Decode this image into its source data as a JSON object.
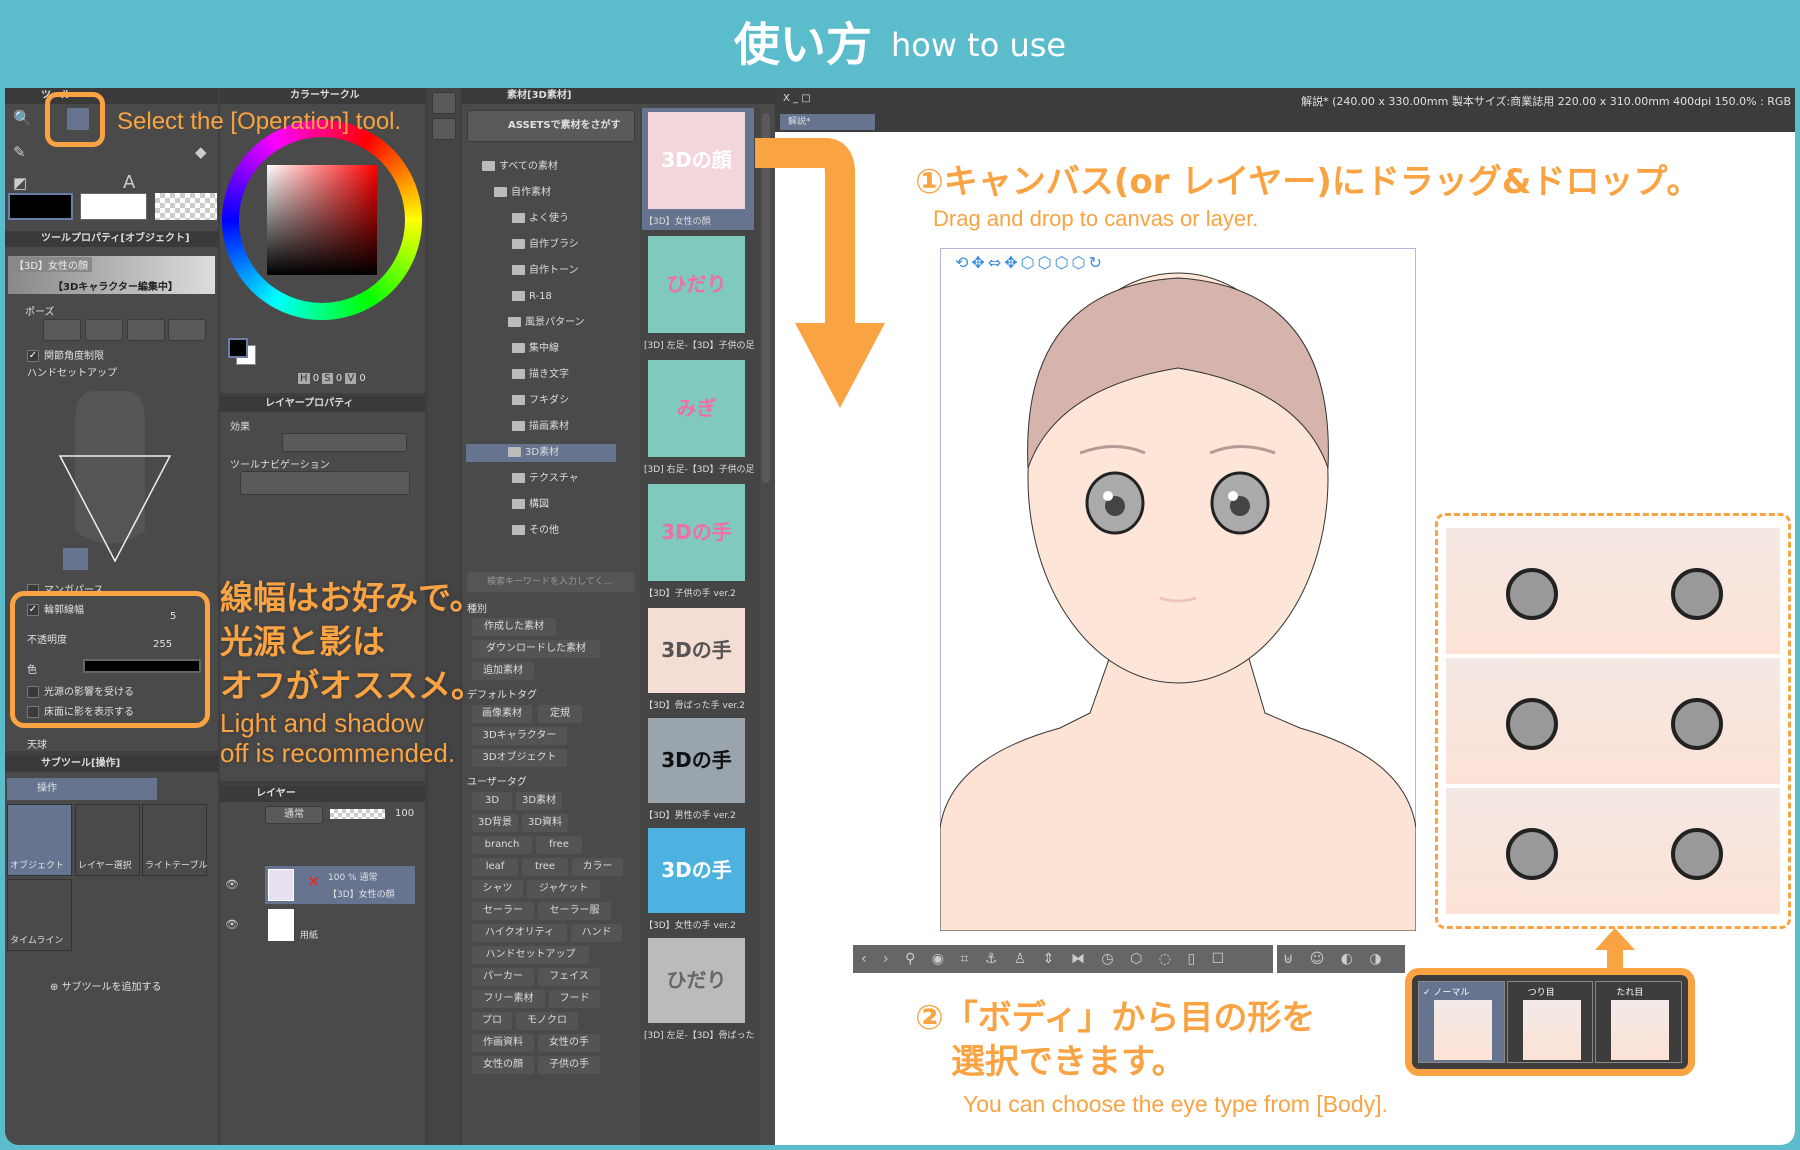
{
  "header": {
    "title_ja": "使い方",
    "title_en": "how to use"
  },
  "colors": {
    "teal": "#5bbdcc",
    "orange": "#f9a342",
    "panel": "#4a4a4a",
    "selected": "#66748f"
  },
  "annotations": {
    "select_tool": "Select the [Operation] tool.",
    "line_ja_1": "線幅はお好みで。",
    "line_ja_2": "光源と影は",
    "line_ja_3": "オフがオススメ。",
    "line_en_1": "Light and shadow",
    "line_en_2": "off is recommended.",
    "step1_ja": "①キャンバス(or レイヤー)にドラッグ&ドロップ。",
    "step1_en": "Drag and drop to canvas or layer.",
    "step2_ja_1": "②「ボディ」から目の形を",
    "step2_ja_2": "選択できます。",
    "step2_en": "You can choose the eye type from [Body]."
  },
  "tool_panel": {
    "tab": "ツール",
    "property_title": "ツールプロパティ[オブジェクト]",
    "material_name": "【3D】女性の顔",
    "editing": "【3Dキャラクター編集中】",
    "pose": "ポーズ",
    "joint_limit": "関節角度制限",
    "hand_setup": "ハンドセットアップ",
    "manga_perspective": "マンガパース",
    "outline_width": {
      "label": "輪郭線幅",
      "value": "5",
      "checked": true
    },
    "opacity": {
      "label": "不透明度",
      "value": "255"
    },
    "color_label": "色",
    "light_effect": {
      "label": "光源の影響を受ける",
      "checked": false
    },
    "floor_shadow": {
      "label": "床面に影を表示する",
      "checked": false
    },
    "sky": "天球"
  },
  "subtool": {
    "title": "サブツール[操作]",
    "group": "操作",
    "items": [
      {
        "label": "オブジェクト"
      },
      {
        "label": "レイヤー選択"
      },
      {
        "label": "ライトテーブル"
      },
      {
        "label": "タイムライン"
      }
    ],
    "add": "サブツールを追加する"
  },
  "color_panel": {
    "title": "カラーサークル",
    "h": "0",
    "s": "0",
    "v": "0",
    "h_label": "H",
    "s_label": "S",
    "v_label": "V"
  },
  "layer_property": {
    "title": "レイヤープロパティ",
    "effect": "効果",
    "tool_nav": "ツールナビゲーション"
  },
  "layer_panel": {
    "title": "レイヤー",
    "blend": "通常",
    "opacity": "100",
    "layers": [
      {
        "info": "100 % 通常",
        "name": "【3D】女性の顔",
        "selected": true
      },
      {
        "info": "",
        "name": "用紙",
        "selected": false
      }
    ]
  },
  "material_panel": {
    "title": "素材[3D素材]",
    "assets_button": "ASSETSで素材をさがす",
    "tree": [
      "すべての素材",
      "自作素材",
      "よく使う",
      "自作ブラシ",
      "自作トーン",
      "R-18",
      "風景パターン",
      "集中線",
      "描き文字",
      "フキダシ",
      "描画素材",
      "3D素材",
      "テクスチャ",
      "構図",
      "その他"
    ],
    "search_placeholder": "検索キーワードを入力してく…",
    "type_label": "種別",
    "type_tags": [
      "作成した素材",
      "ダウンロードした素材",
      "追加素材"
    ],
    "default_tag_label": "デフォルトタグ",
    "default_tags": [
      "画像素材",
      "定規",
      "3Dキャラクター",
      "3Dオブジェクト"
    ],
    "user_tag_label": "ユーザータグ",
    "user_tags": [
      [
        "3D",
        "3D素材"
      ],
      [
        "3D背景",
        "3D資料"
      ],
      [
        "branch",
        "free"
      ],
      [
        "leaf",
        "tree",
        "カラー"
      ],
      [
        "シャツ",
        "ジャケット"
      ],
      [
        "セーラー",
        "セーラー服"
      ],
      [
        "ハイクオリティ",
        "ハンド"
      ],
      [
        "ハンドセットアップ"
      ],
      [
        "パーカー",
        "フェイス"
      ],
      [
        "フリー素材",
        "フード"
      ],
      [
        "プロ",
        "モノクロ"
      ],
      [
        "作画資料",
        "女性の手"
      ],
      [
        "女性の顔",
        "子供の手"
      ]
    ],
    "thumbnails": [
      {
        "label": "【3D】女性の顔",
        "art": "3Dの顔",
        "selected": true
      },
      {
        "label": "[3D] 左足-【3D】子供の足",
        "art": "ひだり"
      },
      {
        "label": "[3D] 右足-【3D】子供の足",
        "art": "みぎ"
      },
      {
        "label": "【3D】子供の手 ver.2",
        "art": "3Dの手"
      },
      {
        "label": "【3D】骨ばった手 ver.2",
        "art": "3Dの手"
      },
      {
        "label": "【3D】男性の手 ver.2",
        "art": "3Dの手"
      },
      {
        "label": "【3D】女性の手 ver.2",
        "art": "3Dの手"
      },
      {
        "label": "[3D] 左足-【3D】骨ばった",
        "art": "ひだり"
      }
    ]
  },
  "canvas": {
    "window_title": "解説* (240.00 x 330.00mm 製本サイズ:商業誌用 220.00 x 310.00mm 400dpi 150.0% : RGB",
    "tab": "解説*",
    "window_controls": "X _ □"
  },
  "eye_popup": {
    "options": [
      {
        "label": "ノーマル",
        "checked": true
      },
      {
        "label": "つり目"
      },
      {
        "label": "たれ目"
      }
    ]
  }
}
